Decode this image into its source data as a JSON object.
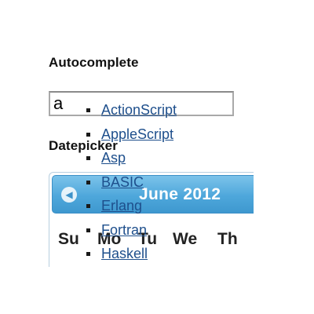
{
  "autocomplete": {
    "title": "Autocomplete",
    "input_value": "a",
    "suggestions": [
      "ActionScript",
      "AppleScript",
      "Asp",
      "BASIC",
      "Erlang",
      "Fortran",
      "Haskell"
    ]
  },
  "datepicker": {
    "title": "Datepicker",
    "prev_icon": "chevron-left-icon",
    "month_label": "June 2012",
    "weekdays": [
      "Su",
      "Mo",
      "Tu",
      "We",
      "Th"
    ]
  },
  "colors": {
    "header_blue": "#4ea7db",
    "link": "#1e4f8c"
  }
}
